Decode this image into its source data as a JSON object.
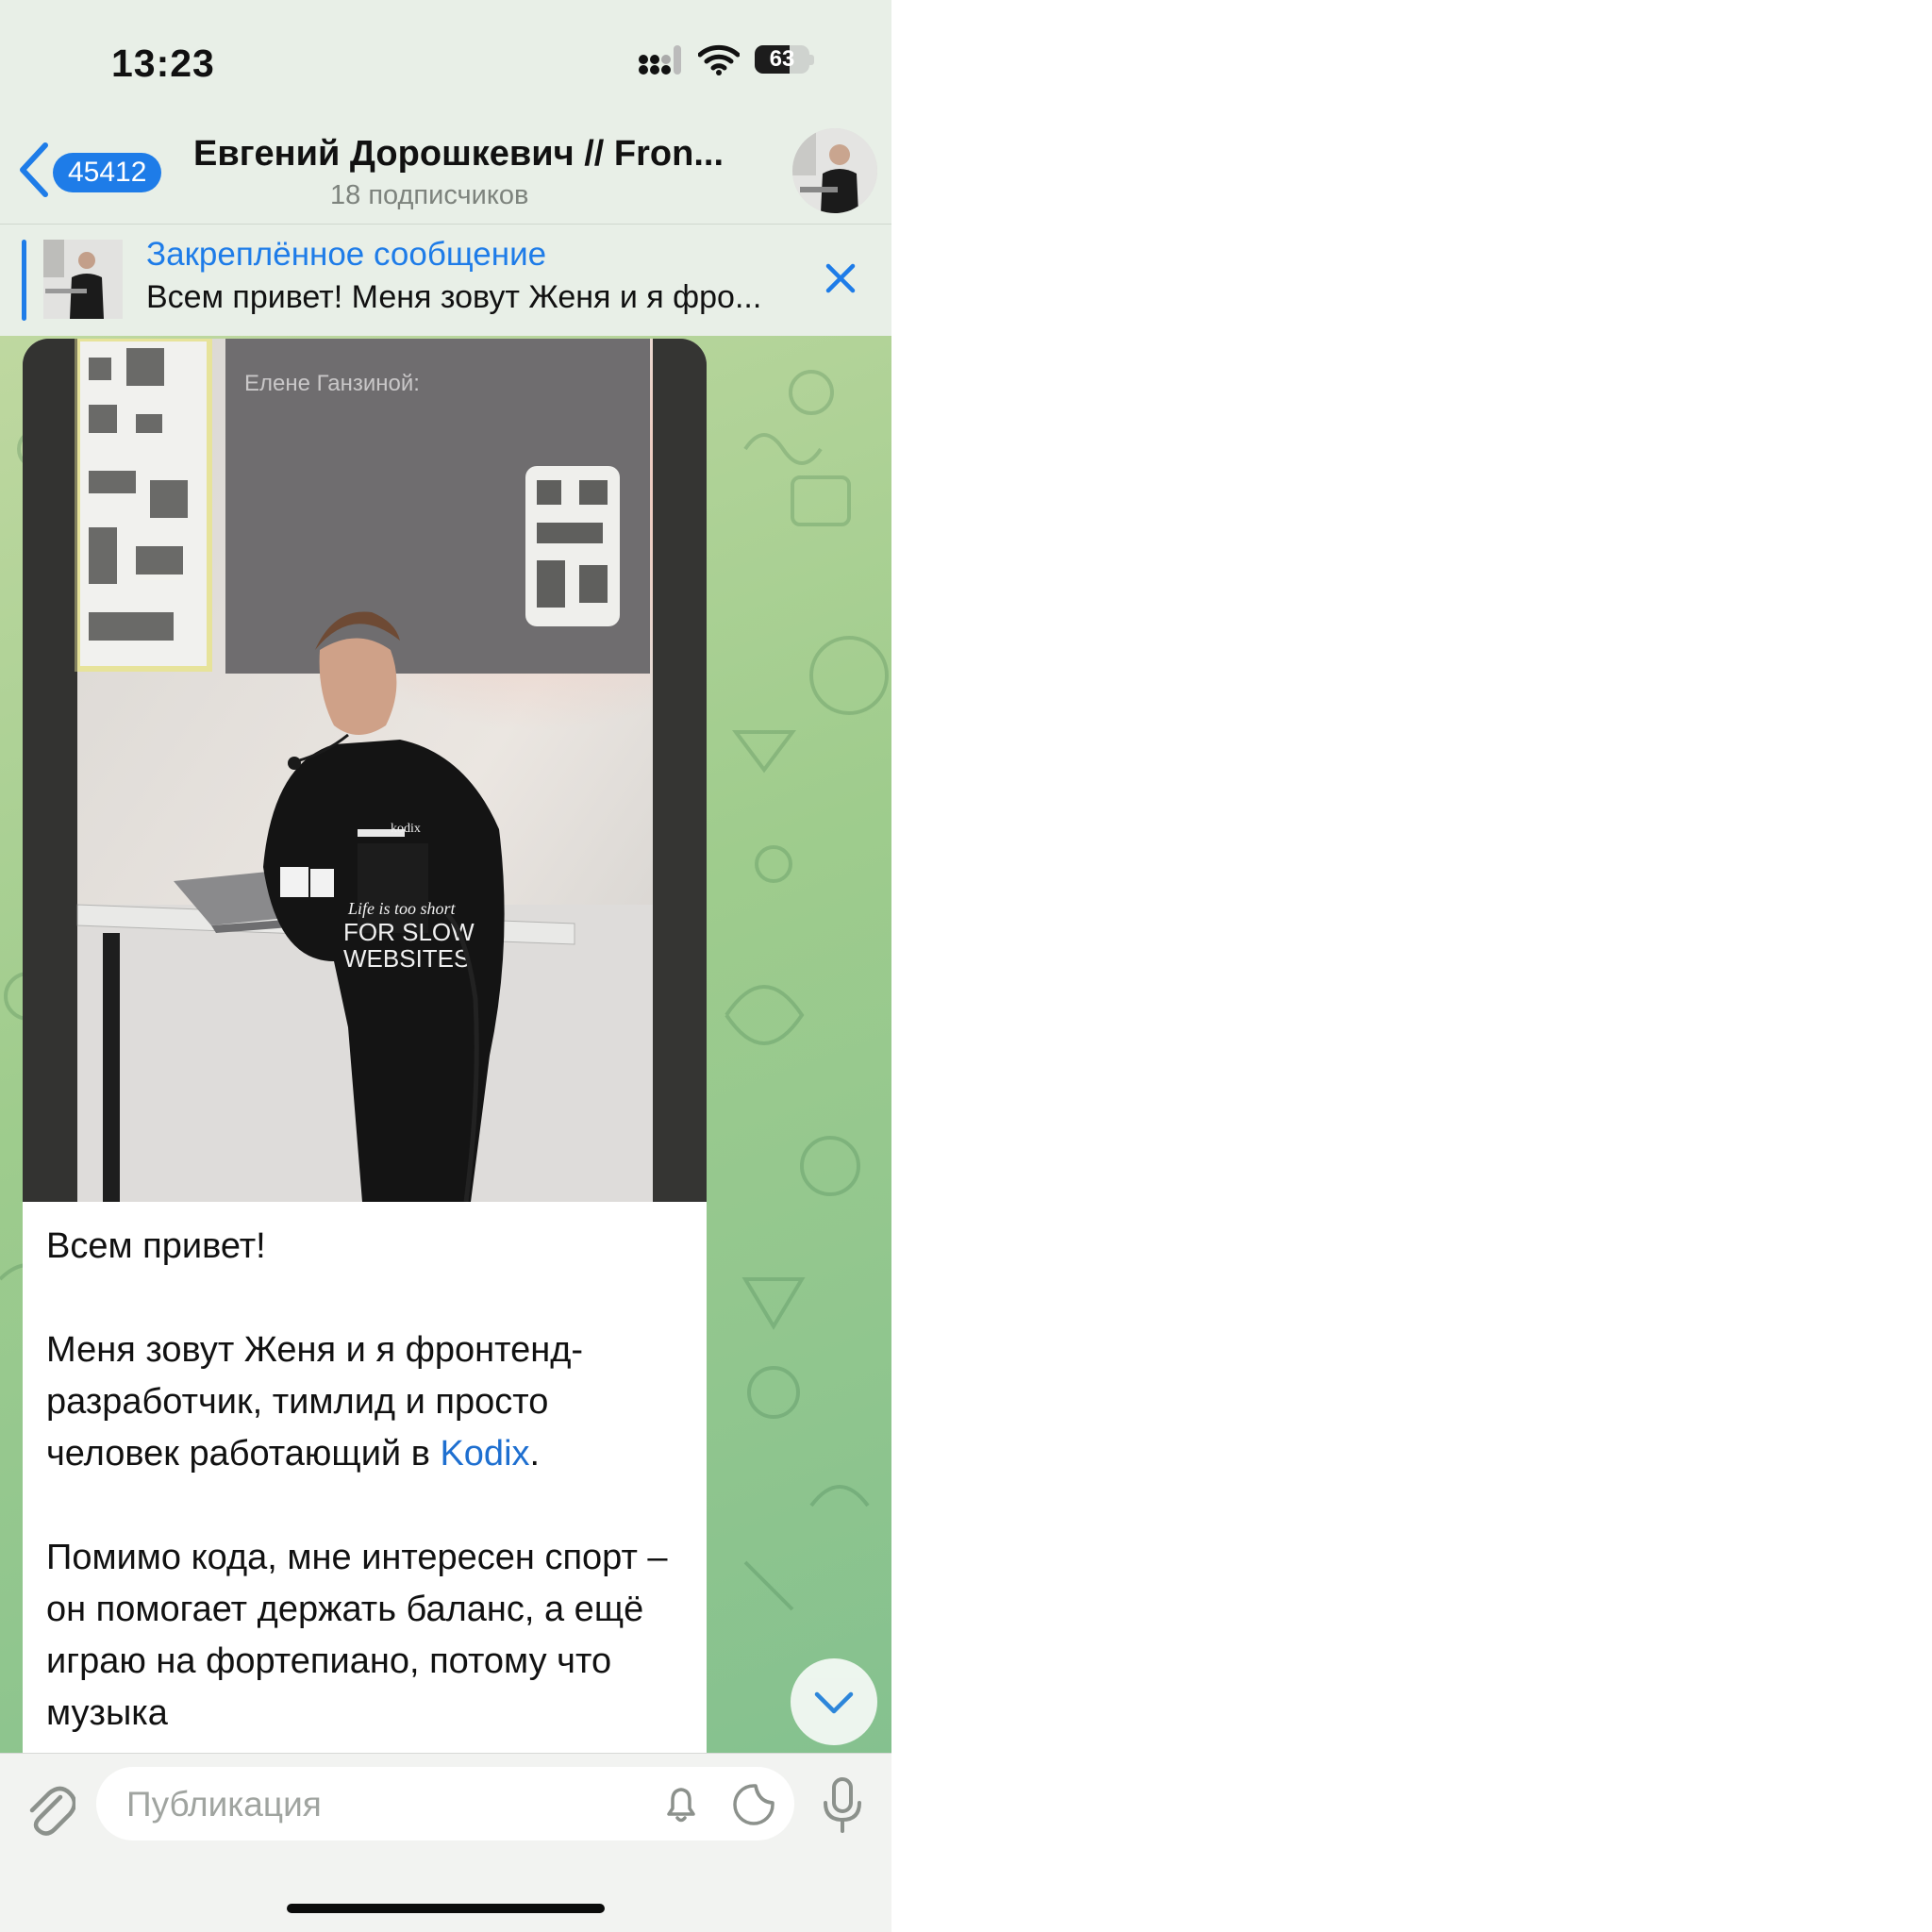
{
  "status_bar": {
    "time": "13:23",
    "battery": "63",
    "battery_level": 0.63
  },
  "header": {
    "back_count": "45412",
    "title": "Евгений Дорошкевич // Fron...",
    "subtitle": "18 подписчиков"
  },
  "pinned": {
    "title": "Закреплённое сообщение",
    "text": "Всем привет! Меня зовут Женя и я фро..."
  },
  "message": {
    "paragraph1": "Всем привет!",
    "paragraph2_before_link": "Меня зовут Женя и я фронтенд-разработчик, тимлид и просто человек работающий в ",
    "paragraph2_link": "Kodix",
    "paragraph2_after_link": ".",
    "paragraph3": "Помимо кода, мне интересен спорт – он помогает держать баланс, а ещё играю на фортепиано, потому что музыка"
  },
  "photo": {
    "slide_title": "Елене Ганзиной:",
    "hoodie_brand": "kodix",
    "hoodie_line1": "Life is too short",
    "hoodie_line2": "FOR SLOW",
    "hoodie_line3": "WEBSITES"
  },
  "composer": {
    "placeholder": "Публикация"
  },
  "icons": {
    "back": "chevron-left-icon",
    "close": "close-icon",
    "scroll": "chevron-down-icon",
    "attach": "paperclip-icon",
    "bell": "bell-icon",
    "sticker": "sticker-icon",
    "mic": "microphone-icon"
  },
  "colors": {
    "accent": "#1e7ce8",
    "link": "#1e6fd0",
    "chat_bg": "#9fcc8d"
  }
}
